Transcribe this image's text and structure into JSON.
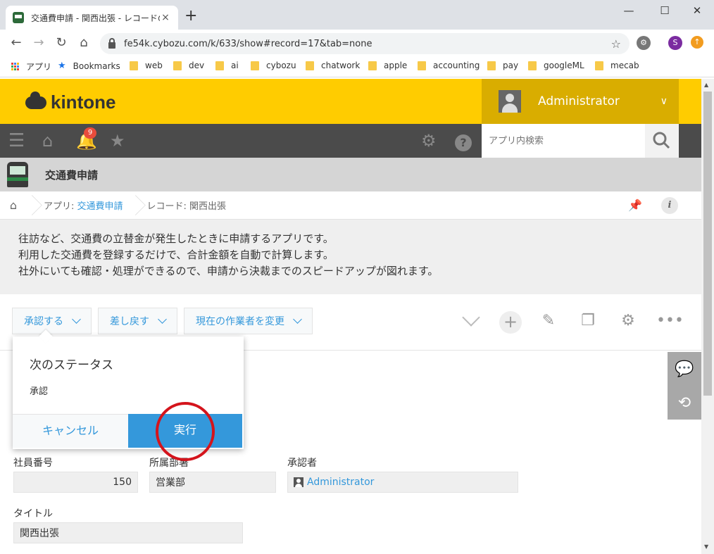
{
  "browser": {
    "tab_title": "交通費申請 - 関西出張 - レコードの",
    "tab_close": "×",
    "new_tab": "+",
    "minimize": "—",
    "maximize": "☐",
    "close": "✕",
    "url": "fe54k.cybozu.com/k/633/show#record=17&tab=none",
    "profile_initial": "S",
    "bookmarks": [
      "アプリ",
      "Bookmarks",
      "web",
      "dev",
      "ai",
      "cybozu",
      "chatwork",
      "apple",
      "accounting",
      "pay",
      "googleML",
      "mecab"
    ]
  },
  "header": {
    "logo_text": "kintone",
    "user_name": "Administrator",
    "user_chevron": "∨"
  },
  "nav": {
    "notification_count": "9",
    "search_placeholder": "アプリ内検索"
  },
  "app": {
    "title": "交通費申請"
  },
  "breadcrumb": {
    "app_prefix": "アプリ: ",
    "app_link": "交通費申請",
    "record": "レコード: 関西出張"
  },
  "description": {
    "lines": [
      "往訪など、交通費の立替金が発生したときに申請するアプリです。",
      "利用した交通費を登録するだけで、合計金額を自動で計算します。",
      "社外にいても確認・処理ができるので、申請から決裁までのスピードアップが図れます。"
    ]
  },
  "actions": {
    "approve": "承認する",
    "send_back": "差し戻す",
    "change_assignee": "現在の作業者を変更"
  },
  "popup": {
    "title": "次のステータス",
    "status": "承認",
    "cancel": "キャンセル",
    "execute": "実行"
  },
  "record": {
    "employee_no_label": "社員番号",
    "employee_no": "150",
    "department_label": "所属部署",
    "department": "営業部",
    "approver_label": "承認者",
    "approver": "Administrator",
    "title_label": "タイトル",
    "title": "関西出張"
  },
  "colors": {
    "kintone_yellow": "#ffcc00",
    "nav_dark": "#4b4b4b",
    "link_blue": "#3498db",
    "highlight_red": "#d4141c"
  }
}
